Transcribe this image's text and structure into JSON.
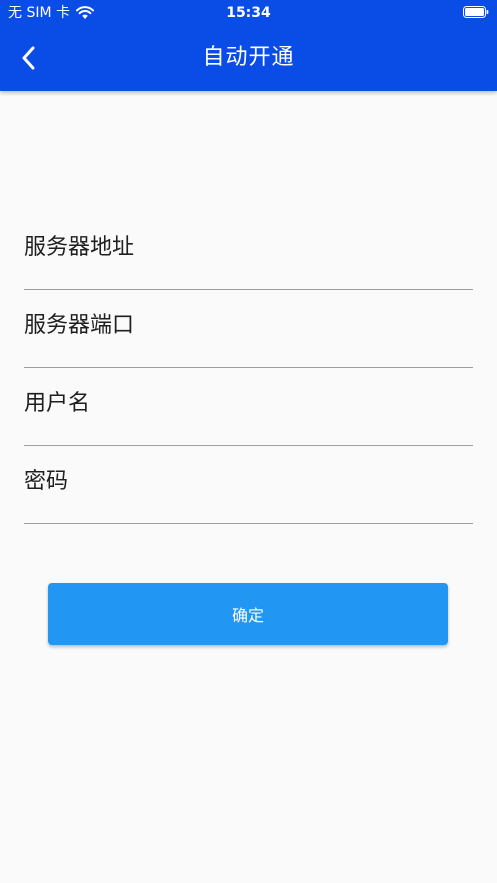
{
  "status_bar": {
    "carrier": "无 SIM 卡",
    "time": "15:34",
    "wifi_icon": "wifi-icon",
    "battery_icon": "battery-icon"
  },
  "nav": {
    "title": "自动开通",
    "back_icon": "chevron-left-icon"
  },
  "form": {
    "fields": [
      {
        "label": "服务器地址",
        "value": ""
      },
      {
        "label": "服务器端口",
        "value": ""
      },
      {
        "label": "用户名",
        "value": ""
      },
      {
        "label": "密码",
        "value": ""
      }
    ],
    "confirm_label": "确定"
  },
  "colors": {
    "app_bar": "#0a4de6",
    "button": "#2196f3",
    "background": "#fafafa",
    "divider": "#9e9e9e"
  }
}
